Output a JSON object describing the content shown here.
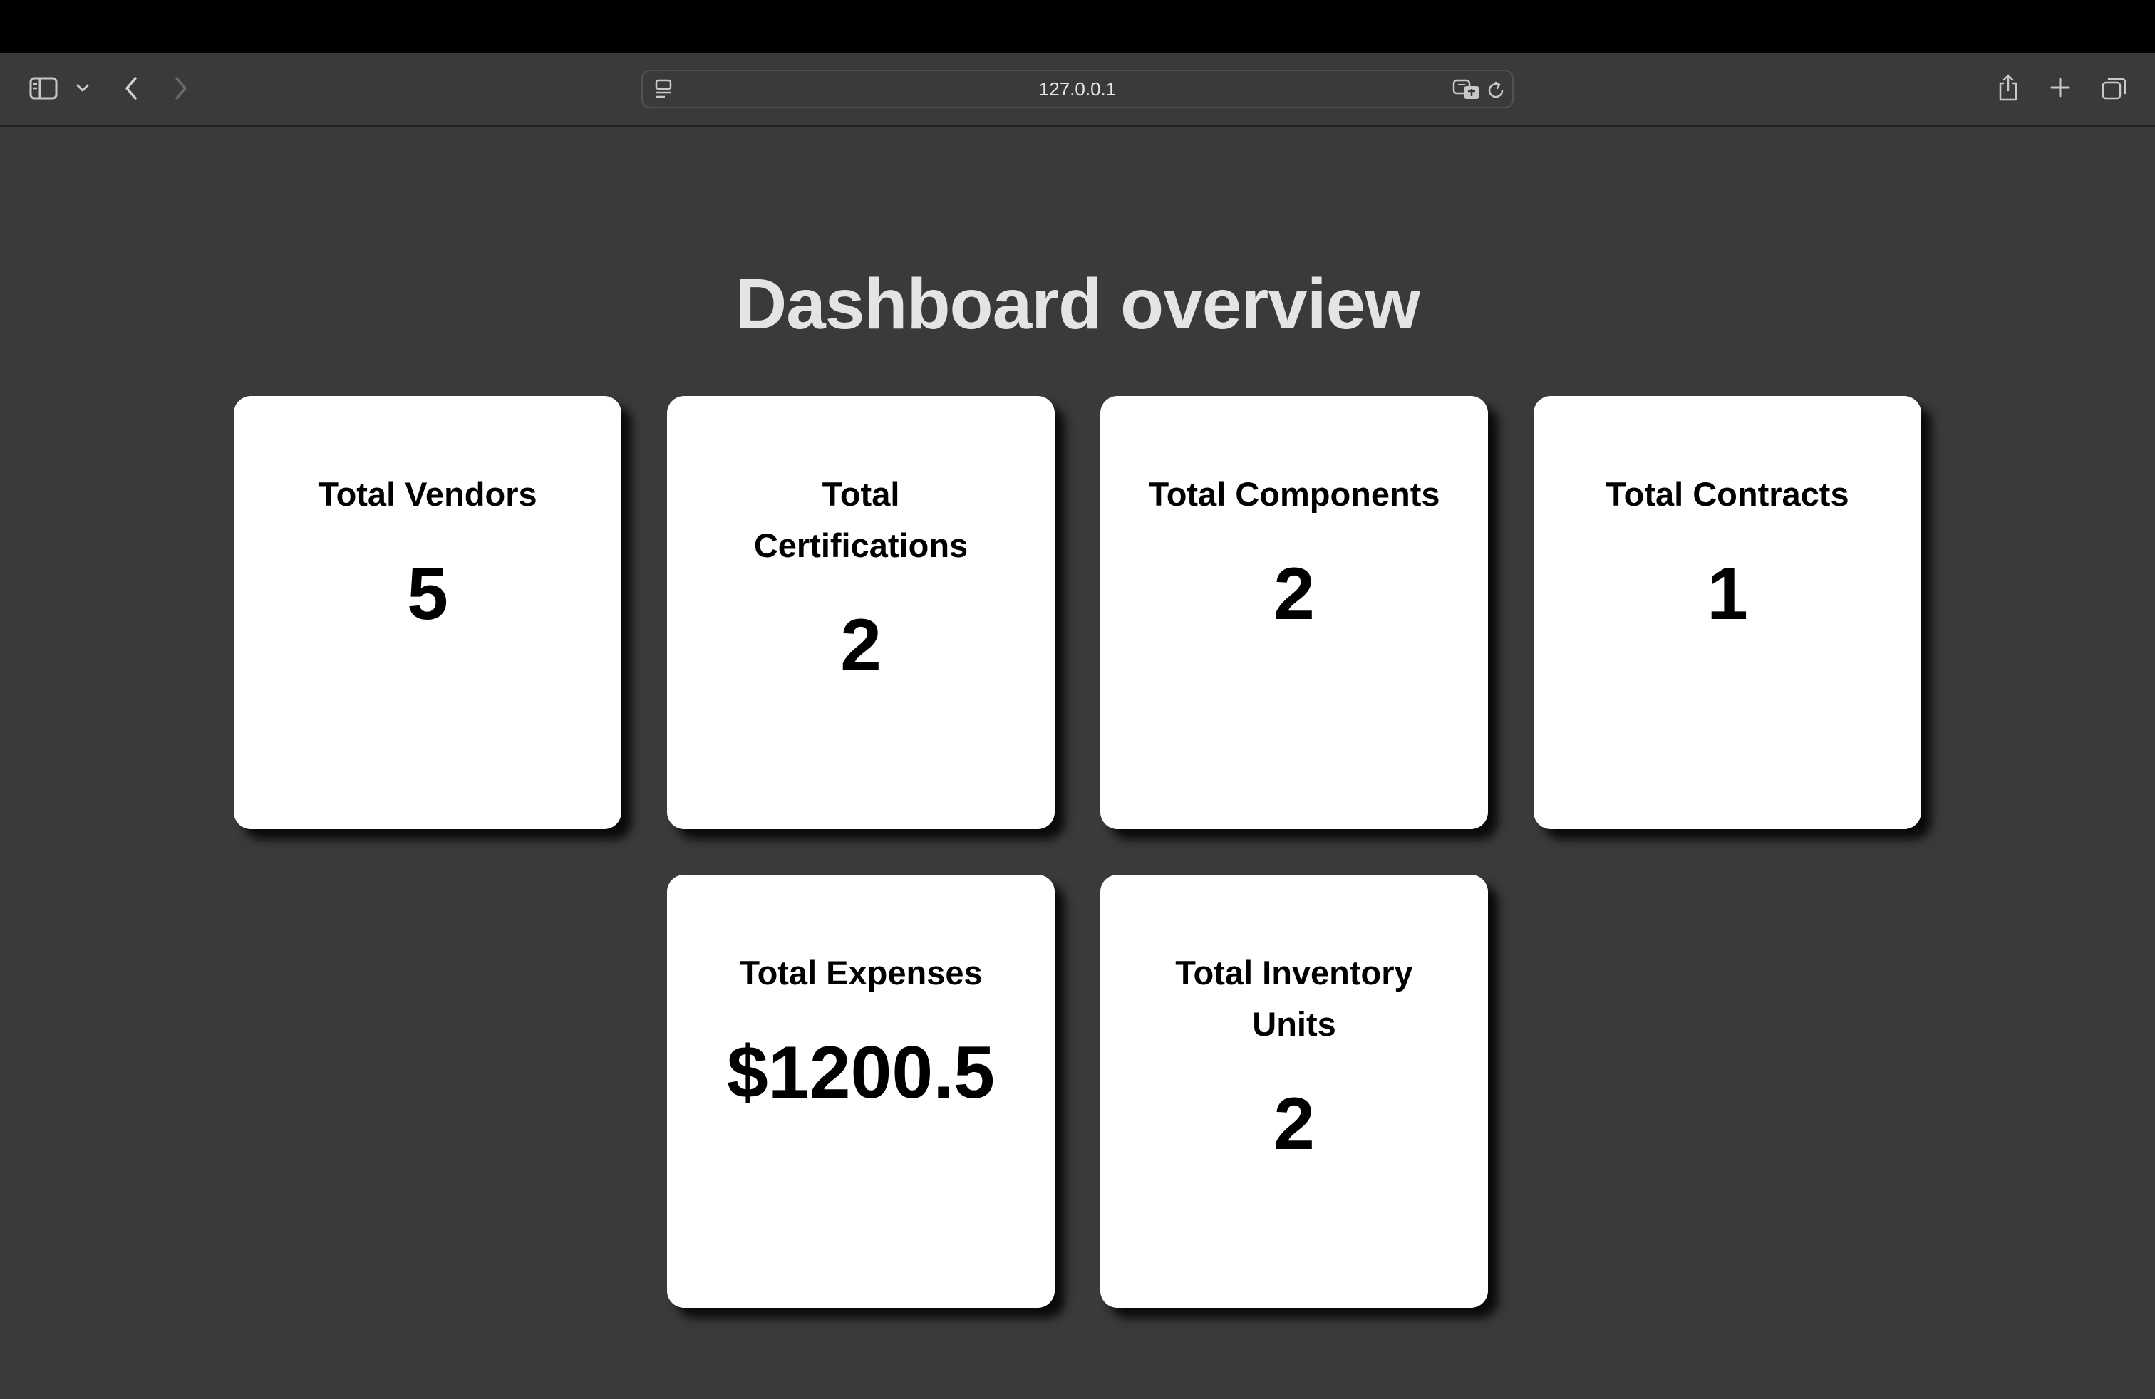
{
  "browser": {
    "url": "127.0.0.1",
    "icons": {
      "sidebar": "sidebar-icon",
      "chevron": "chevron-down-icon",
      "back": "back-icon",
      "forward": "forward-icon",
      "page_menu": "page-menu-icon",
      "translate": "translate-icon",
      "reload": "reload-icon",
      "share": "share-icon",
      "new_tab": "plus-icon",
      "tabs": "tabs-overview-icon"
    }
  },
  "page": {
    "title": "Dashboard overview",
    "cards": [
      {
        "label": "Total Vendors",
        "value": "5"
      },
      {
        "label": "Total Certifications",
        "value": "2"
      },
      {
        "label": "Total Components",
        "value": "2"
      },
      {
        "label": "Total Contracts",
        "value": "1"
      },
      {
        "label": "Total Expenses",
        "value": "$1200.5"
      },
      {
        "label": "Total Inventory Units",
        "value": "2"
      }
    ]
  },
  "colors": {
    "page_background": "#3a3a3a",
    "card_background": "#ffffff",
    "title_text": "#e4e4e4"
  }
}
